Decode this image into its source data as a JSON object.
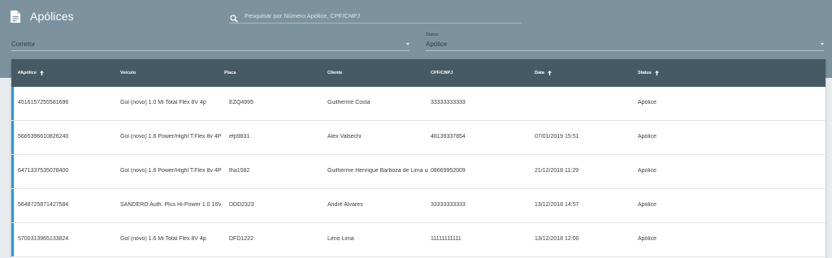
{
  "header": {
    "title": "Apólices",
    "icon": "document-icon",
    "search": {
      "placeholder": "Pesquisar por Número Apólice, CPF/CNPJ",
      "value": ""
    }
  },
  "filters": {
    "corretor": {
      "label": "",
      "value": "Corretor"
    },
    "status": {
      "label": "Status",
      "value": "Apólice"
    }
  },
  "table": {
    "columns": [
      {
        "label": "#Apólice",
        "sort": "asc"
      },
      {
        "label": "Veículo",
        "sort": ""
      },
      {
        "label": "Placa",
        "sort": ""
      },
      {
        "label": "Cliente",
        "sort": ""
      },
      {
        "label": "CPF/CNPJ",
        "sort": ""
      },
      {
        "label": "Data",
        "sort": "asc"
      },
      {
        "label": "Status",
        "sort": "asc"
      }
    ],
    "rows": [
      {
        "apolice": "4516157255581696",
        "veiculo": "Gol (novo) 1.0 Mi Total Flex 8V 4p",
        "placa": "EZQ4995",
        "cliente": "Guilherme Costa",
        "cpf": "33333333333",
        "data": "",
        "status": "Apólice"
      },
      {
        "apolice": "5665396610826240",
        "veiculo": "Gol (novo) 1.6 Power/Highl T.Flex 8v 4P",
        "placa": "efp9831",
        "cliente": "Alex Valsechi",
        "cpf": "48139337854",
        "data": "07/01/2019 15:51",
        "status": "Apólice"
      },
      {
        "apolice": "6471337535078400",
        "veiculo": "Gol (novo) 1.6 Power/Highl T.Flex 8v 4P",
        "placa": "fha1582",
        "cliente": "Guilherme Henrique Barboza de Lima ui",
        "cpf": "08669952009",
        "data": "21/12/2018 11:29",
        "status": "Apólice"
      },
      {
        "apolice": "5648725871427584",
        "veiculo": "SANDERO Auth. Plus Hi-Power 1.0 16V...",
        "placa": "DDD2323",
        "cliente": "André Alvares",
        "cpf": "33333333333",
        "data": "13/12/2018 14:57",
        "status": "Apólice"
      },
      {
        "apolice": "5700313965133824",
        "veiculo": "Gol (novo) 1.6 Mi Total Flex 8V 4p",
        "placa": "DFD1222",
        "cliente": "Leno Lima",
        "cpf": "11111111111",
        "data": "13/12/2018 12:00",
        "status": "Apólice"
      }
    ]
  },
  "colors": {
    "header_bg": "#7c939f",
    "table_header_bg": "#455a64",
    "row_accent": "#2196f3"
  }
}
